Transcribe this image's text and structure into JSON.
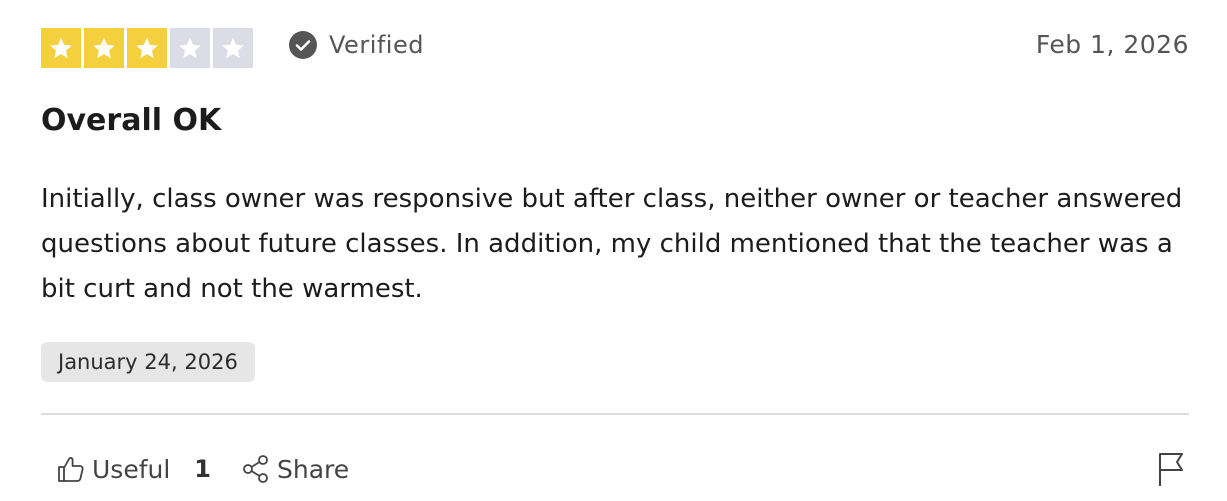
{
  "rating": {
    "value": 3,
    "max": 5,
    "filled_color": "#f5d03e",
    "empty_color": "#dcdce6"
  },
  "verified_label": "Verified",
  "date": "Feb 1, 2026",
  "title": "Overall OK",
  "body": "Initially, class owner was responsive but after class, neither owner or teacher answered questions about future classes. In addition, my child mentioned that the teacher was a bit curt and not the warmest.",
  "experience_date": "January 24, 2026",
  "actions": {
    "useful_label": "Useful",
    "useful_count": "1",
    "share_label": "Share"
  },
  "icons": [
    "star-icon",
    "check-circle-icon",
    "thumbs-up-icon",
    "share-icon",
    "flag-icon"
  ]
}
